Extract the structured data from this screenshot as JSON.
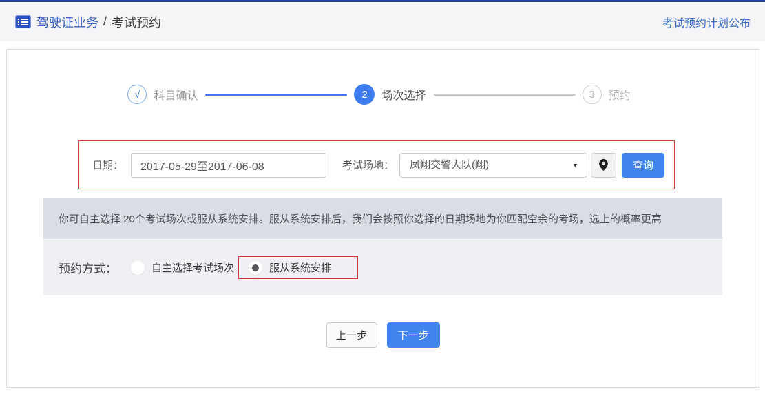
{
  "header": {
    "breadcrumb_primary": "驾驶证业务",
    "breadcrumb_separator": "/",
    "breadcrumb_secondary": "考试预约",
    "plan_link": "考试预约计划公布"
  },
  "stepper": {
    "steps": [
      {
        "marker": "√",
        "label": "科目确认",
        "state": "done"
      },
      {
        "marker": "2",
        "label": "场次选择",
        "state": "active"
      },
      {
        "marker": "3",
        "label": "预约",
        "state": "pending"
      }
    ]
  },
  "filter": {
    "date_label": "日期：",
    "date_value": "2017-05-29至2017-06-08",
    "venue_label": "考试场地：",
    "venue_value": "凤翔交警大队(翔)",
    "search_label": "查询"
  },
  "icons": {
    "dropdown": "▼"
  },
  "notice": "你可自主选择 20个考试场次或服从系统安排。服从系统安排后，我们会按照你选择的日期场地为你匹配空余的考场，选上的概率更高",
  "booking": {
    "label": "预约方式：",
    "options": [
      {
        "label": "自主选择考试场次",
        "selected": false
      },
      {
        "label": "服从系统安排",
        "selected": true
      }
    ]
  },
  "footer": {
    "prev_label": "上一步",
    "next_label": "下一步"
  },
  "colors": {
    "top_accent": "#27479c",
    "accent_blue": "#4184ee",
    "stepper_blue": "#3e7bf0",
    "highlight_red": "#d93a32",
    "notice_bg": "#d9dde5",
    "section_bg": "#eef0f3"
  }
}
